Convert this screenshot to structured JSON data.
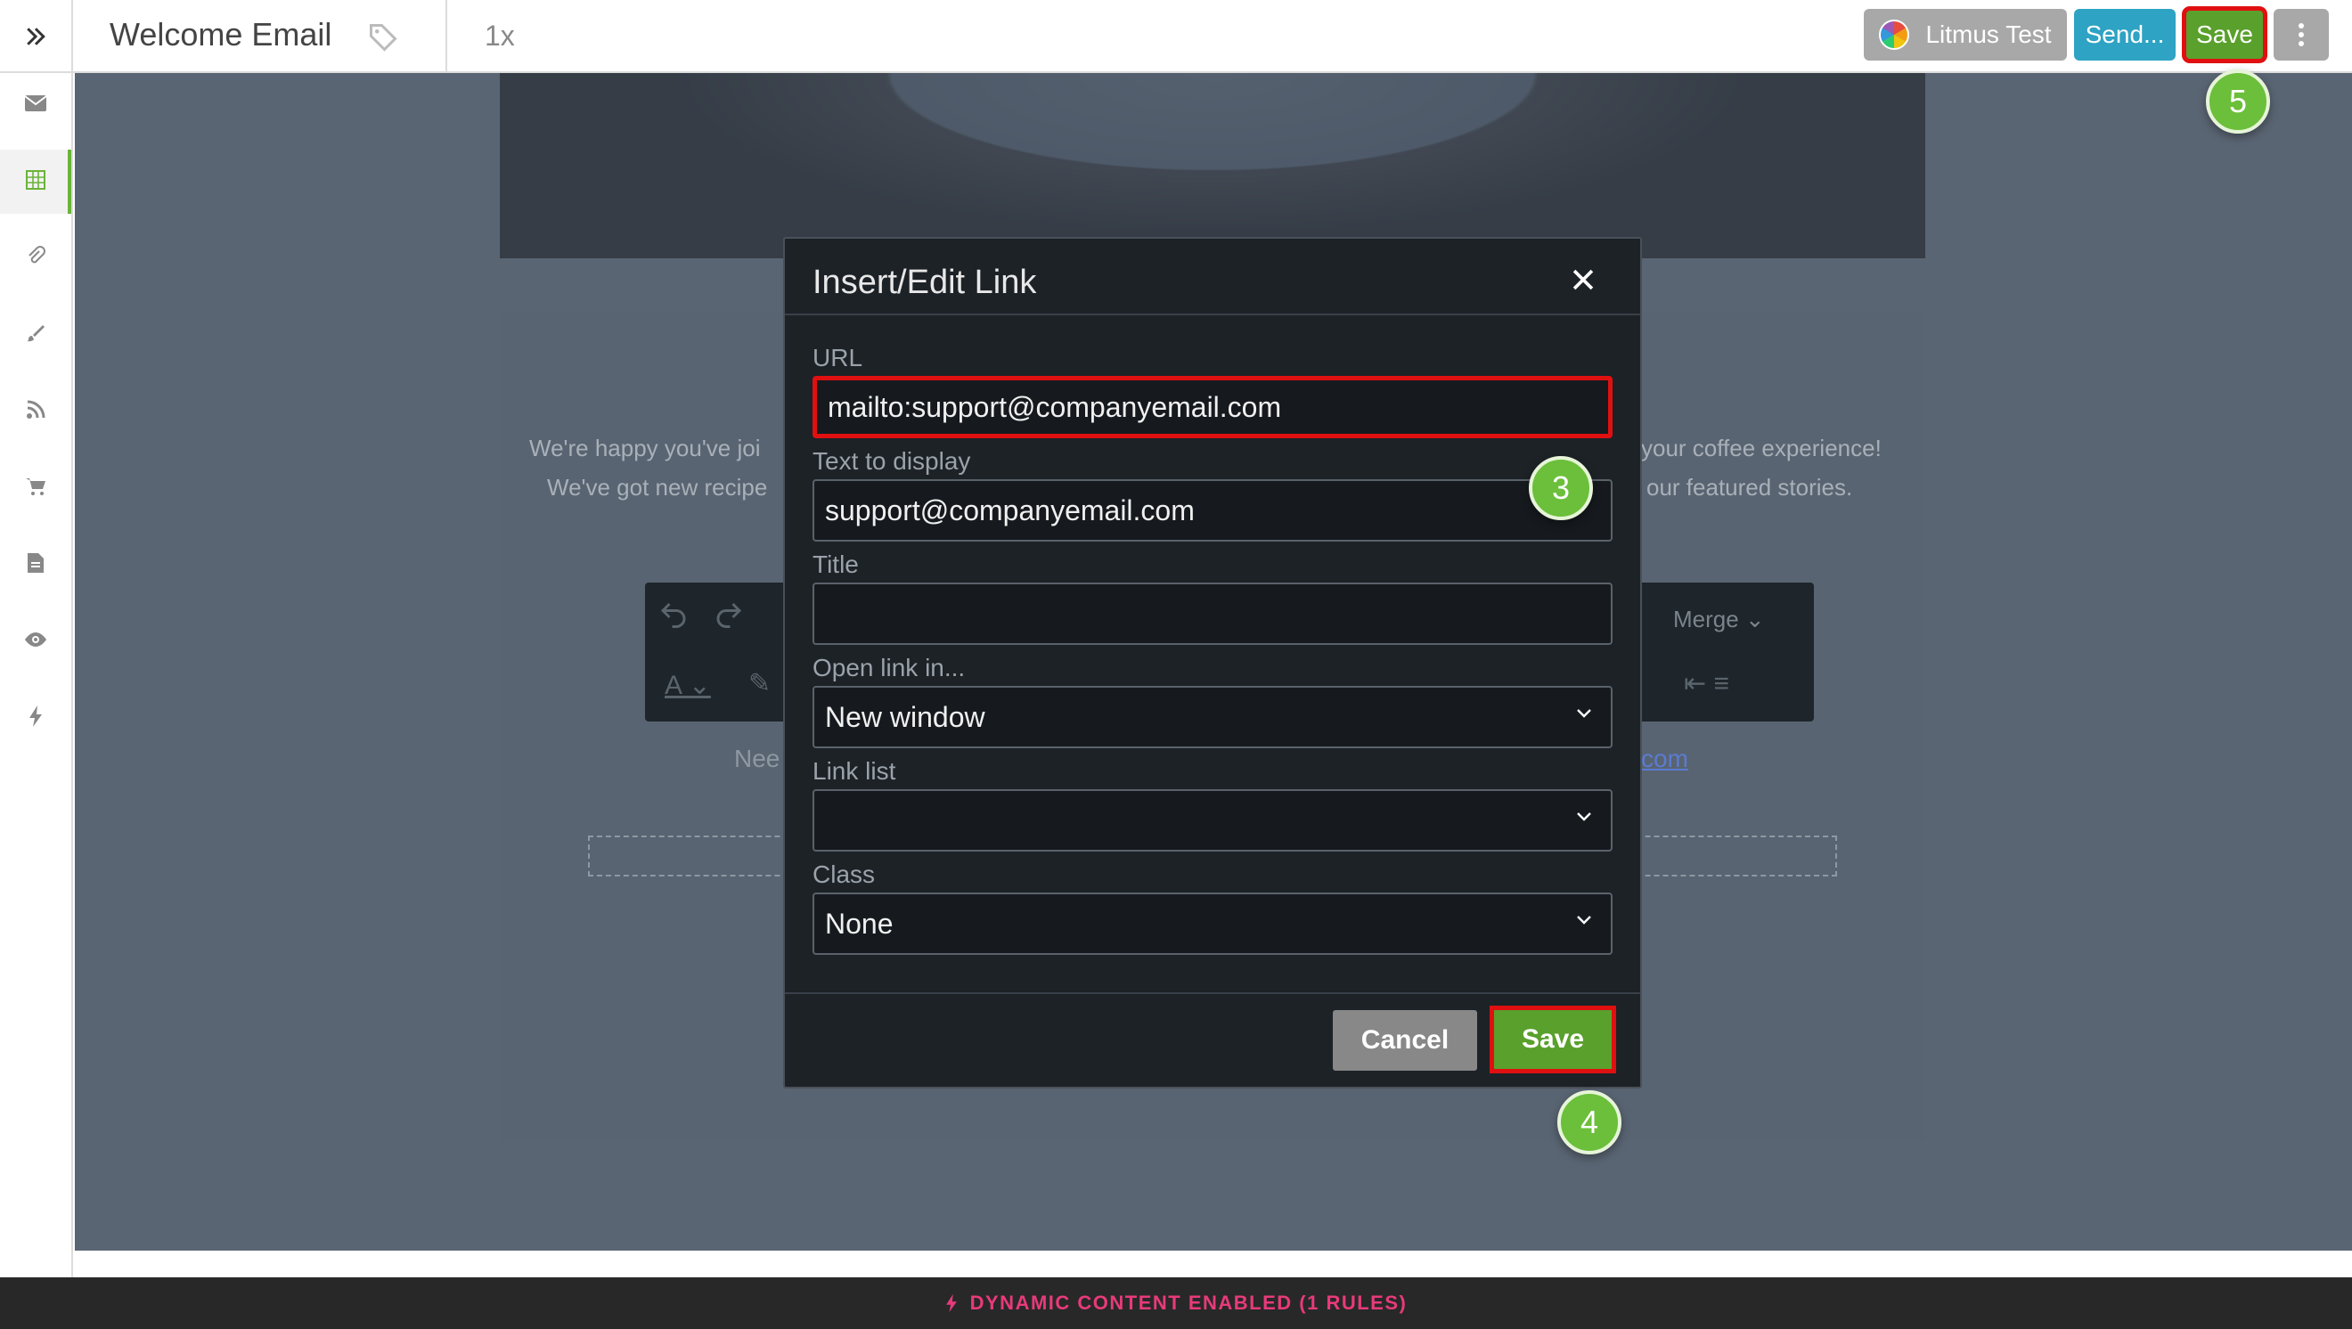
{
  "header": {
    "title": "Welcome Email",
    "zoom": "1x",
    "buttons": {
      "litmus": "Litmus Test",
      "send": "Send...",
      "save": "Save",
      "more_icon": "vertical-dots-icon"
    }
  },
  "sidebar": {
    "icons": [
      "envelope-icon",
      "grid-icon",
      "paperclip-icon",
      "brush-icon",
      "rss-icon",
      "cart-icon",
      "document-icon",
      "eye-icon",
      "bolt-icon"
    ],
    "active_index": 1
  },
  "background": {
    "line1_left": "We're happy you've joi",
    "line1_right": "your coffee experience!",
    "line2_left": "We've got new recipe",
    "line2_right": "our featured stories.",
    "need_text": "Nee",
    "com_text": "com",
    "merge_label": "Merge"
  },
  "modal": {
    "title": "Insert/Edit Link",
    "url_label": "URL",
    "url_value": "mailto:support@companyemail.com",
    "display_label": "Text to display",
    "display_value": "support@companyemail.com",
    "title_label": "Title",
    "title_value": "",
    "open_label": "Open link in...",
    "open_value": "New window",
    "linklist_label": "Link list",
    "linklist_value": "",
    "class_label": "Class",
    "class_value": "None",
    "cancel": "Cancel",
    "save": "Save"
  },
  "badges": {
    "step3": "3",
    "step4": "4",
    "step5": "5"
  },
  "footer": {
    "status": "DYNAMIC CONTENT ENABLED (1 RULES)"
  },
  "colors": {
    "save_green": "#5aa02c",
    "send_blue": "#2ea3c3",
    "highlight_red": "#e01010",
    "footer_pink": "#e83a7a"
  }
}
